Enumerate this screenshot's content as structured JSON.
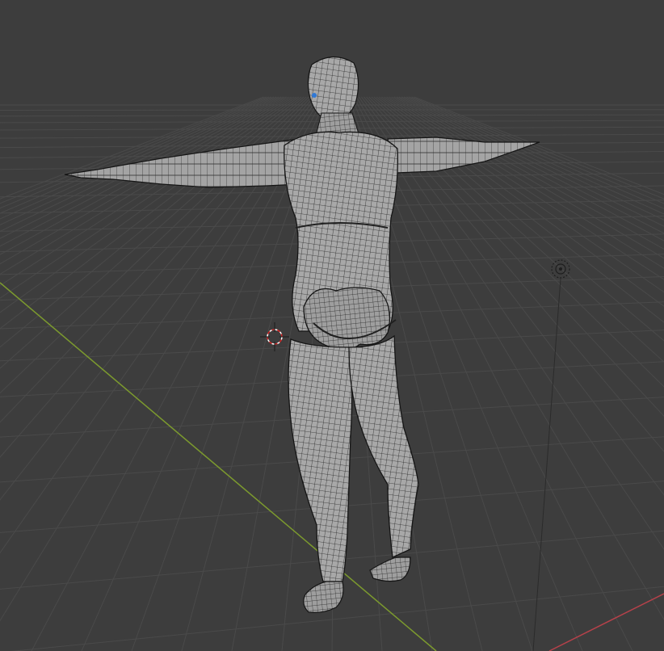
{
  "viewport": {
    "background": "#3d3d3d",
    "grid_color": "#4a4a4a",
    "grid_major_color": "#555555",
    "x_axis_color": "#b5414a",
    "y_axis_color": "#7c9a2e",
    "mesh_fill": "#9a9a9a",
    "mesh_wire": "#1a1a1a"
  },
  "objects": {
    "mesh_name": "",
    "light_name": ""
  },
  "icons": {
    "cursor": "3d-cursor-icon",
    "light": "light-object-icon"
  }
}
